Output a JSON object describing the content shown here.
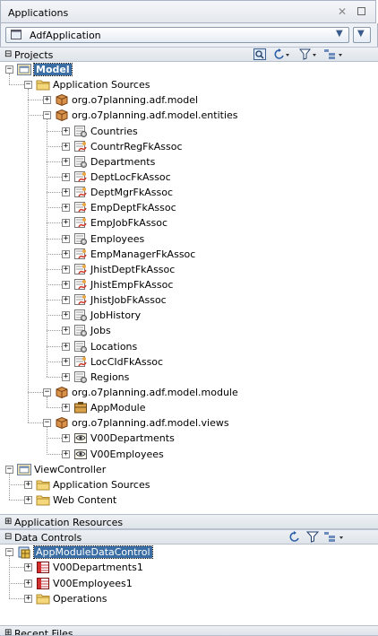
{
  "window": {
    "title": "Applications"
  },
  "app_selector": {
    "value": "AdfApplication"
  },
  "projects": {
    "title": "Projects",
    "tree": [
      {
        "id": "model",
        "label": "Model",
        "level": 0,
        "expander": "−",
        "icon": "project",
        "selected": true
      },
      {
        "id": "app-sources",
        "label": "Application Sources",
        "level": 1,
        "expander": "−",
        "icon": "folder"
      },
      {
        "id": "pkg-model",
        "label": "org.o7planning.adf.model",
        "level": 2,
        "expander": "+",
        "icon": "package"
      },
      {
        "id": "pkg-entities",
        "label": "org.o7planning.adf.model.entities",
        "level": 2,
        "expander": "−",
        "icon": "package"
      },
      {
        "id": "countries",
        "label": "Countries",
        "level": 3,
        "expander": "+",
        "icon": "entity"
      },
      {
        "id": "countrregfk",
        "label": "CountrRegFkAssoc",
        "level": 3,
        "expander": "+",
        "icon": "assoc"
      },
      {
        "id": "departments",
        "label": "Departments",
        "level": 3,
        "expander": "+",
        "icon": "entity"
      },
      {
        "id": "deptlocfk",
        "label": "DeptLocFkAssoc",
        "level": 3,
        "expander": "+",
        "icon": "assoc"
      },
      {
        "id": "deptmgrfk",
        "label": "DeptMgrFkAssoc",
        "level": 3,
        "expander": "+",
        "icon": "assoc"
      },
      {
        "id": "empdeptfk",
        "label": "EmpDeptFkAssoc",
        "level": 3,
        "expander": "+",
        "icon": "assoc"
      },
      {
        "id": "empjobfk",
        "label": "EmpJobFkAssoc",
        "level": 3,
        "expander": "+",
        "icon": "assoc"
      },
      {
        "id": "employees",
        "label": "Employees",
        "level": 3,
        "expander": "+",
        "icon": "entity"
      },
      {
        "id": "empmanagerfk",
        "label": "EmpManagerFkAssoc",
        "level": 3,
        "expander": "+",
        "icon": "assoc"
      },
      {
        "id": "jhistdeptfk",
        "label": "JhistDeptFkAssoc",
        "level": 3,
        "expander": "+",
        "icon": "assoc"
      },
      {
        "id": "jhistempfk",
        "label": "JhistEmpFkAssoc",
        "level": 3,
        "expander": "+",
        "icon": "assoc"
      },
      {
        "id": "jhistjobfk",
        "label": "JhistJobFkAssoc",
        "level": 3,
        "expander": "+",
        "icon": "assoc"
      },
      {
        "id": "jobhistory",
        "label": "JobHistory",
        "level": 3,
        "expander": "+",
        "icon": "entity"
      },
      {
        "id": "jobs",
        "label": "Jobs",
        "level": 3,
        "expander": "+",
        "icon": "entity"
      },
      {
        "id": "locations",
        "label": "Locations",
        "level": 3,
        "expander": "+",
        "icon": "entity"
      },
      {
        "id": "loccidfk",
        "label": "LocCIdFkAssoc",
        "level": 3,
        "expander": "+",
        "icon": "assoc"
      },
      {
        "id": "regions",
        "label": "Regions",
        "level": 3,
        "expander": "+",
        "icon": "entity"
      },
      {
        "id": "pkg-module",
        "label": "org.o7planning.adf.model.module",
        "level": 2,
        "expander": "−",
        "icon": "package"
      },
      {
        "id": "appmodule",
        "label": "AppModule",
        "level": 3,
        "expander": "+",
        "icon": "appmodule"
      },
      {
        "id": "pkg-views",
        "label": "org.o7planning.adf.model.views",
        "level": 2,
        "expander": "−",
        "icon": "package"
      },
      {
        "id": "v00departments",
        "label": "V00Departments",
        "level": 3,
        "expander": "+",
        "icon": "view"
      },
      {
        "id": "v00employees",
        "label": "V00Employees",
        "level": 3,
        "expander": "+",
        "icon": "view"
      },
      {
        "id": "viewcontroller",
        "label": "ViewController",
        "level": 0,
        "expander": "−",
        "icon": "project"
      },
      {
        "id": "vc-app-sources",
        "label": "Application Sources",
        "level": 1,
        "expander": "+",
        "icon": "folder"
      },
      {
        "id": "web-content",
        "label": "Web Content",
        "level": 1,
        "expander": "+",
        "icon": "folder"
      }
    ]
  },
  "app_resources": {
    "title": "Application Resources"
  },
  "data_controls": {
    "title": "Data Controls",
    "tree": [
      {
        "id": "appmoduledc",
        "label": "AppModuleDataControl",
        "level": 0,
        "expander": "−",
        "icon": "datacontrol",
        "selected": true
      },
      {
        "id": "dc-v00departments1",
        "label": "V00Departments1",
        "level": 1,
        "expander": "+",
        "icon": "collection"
      },
      {
        "id": "dc-v00employees1",
        "label": "V00Employees1",
        "level": 1,
        "expander": "+",
        "icon": "collection"
      },
      {
        "id": "operations",
        "label": "Operations",
        "level": 1,
        "expander": "+",
        "icon": "folder"
      }
    ]
  },
  "recent_files": {
    "title": "Recent Files"
  },
  "colors": {
    "selection": "#3a6ea5",
    "header": "#dfe4ea",
    "folder": "#e8c35a",
    "package": "#b86d2b"
  }
}
